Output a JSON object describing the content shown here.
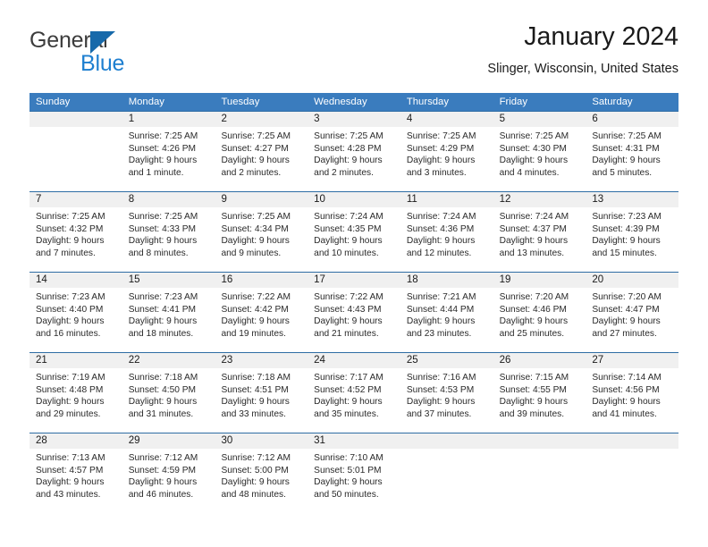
{
  "brand": {
    "name_top": "General",
    "name_bottom": "Blue",
    "accent_color": "#1769aa",
    "blue_text_color": "#1e7fd0"
  },
  "header": {
    "title": "January 2024",
    "subtitle": "Slinger, Wisconsin, United States"
  },
  "theme": {
    "header_bg": "#3a7cbe",
    "week_divider": "#2e6da4",
    "daynum_bg": "#f0f0f0"
  },
  "weekdays": [
    "Sunday",
    "Monday",
    "Tuesday",
    "Wednesday",
    "Thursday",
    "Friday",
    "Saturday"
  ],
  "weeks": [
    {
      "days": [
        {
          "num": "",
          "sunrise": "",
          "sunset": "",
          "daylight": ""
        },
        {
          "num": "1",
          "sunrise": "Sunrise: 7:25 AM",
          "sunset": "Sunset: 4:26 PM",
          "daylight": "Daylight: 9 hours and 1 minute."
        },
        {
          "num": "2",
          "sunrise": "Sunrise: 7:25 AM",
          "sunset": "Sunset: 4:27 PM",
          "daylight": "Daylight: 9 hours and 2 minutes."
        },
        {
          "num": "3",
          "sunrise": "Sunrise: 7:25 AM",
          "sunset": "Sunset: 4:28 PM",
          "daylight": "Daylight: 9 hours and 2 minutes."
        },
        {
          "num": "4",
          "sunrise": "Sunrise: 7:25 AM",
          "sunset": "Sunset: 4:29 PM",
          "daylight": "Daylight: 9 hours and 3 minutes."
        },
        {
          "num": "5",
          "sunrise": "Sunrise: 7:25 AM",
          "sunset": "Sunset: 4:30 PM",
          "daylight": "Daylight: 9 hours and 4 minutes."
        },
        {
          "num": "6",
          "sunrise": "Sunrise: 7:25 AM",
          "sunset": "Sunset: 4:31 PM",
          "daylight": "Daylight: 9 hours and 5 minutes."
        }
      ]
    },
    {
      "days": [
        {
          "num": "7",
          "sunrise": "Sunrise: 7:25 AM",
          "sunset": "Sunset: 4:32 PM",
          "daylight": "Daylight: 9 hours and 7 minutes."
        },
        {
          "num": "8",
          "sunrise": "Sunrise: 7:25 AM",
          "sunset": "Sunset: 4:33 PM",
          "daylight": "Daylight: 9 hours and 8 minutes."
        },
        {
          "num": "9",
          "sunrise": "Sunrise: 7:25 AM",
          "sunset": "Sunset: 4:34 PM",
          "daylight": "Daylight: 9 hours and 9 minutes."
        },
        {
          "num": "10",
          "sunrise": "Sunrise: 7:24 AM",
          "sunset": "Sunset: 4:35 PM",
          "daylight": "Daylight: 9 hours and 10 minutes."
        },
        {
          "num": "11",
          "sunrise": "Sunrise: 7:24 AM",
          "sunset": "Sunset: 4:36 PM",
          "daylight": "Daylight: 9 hours and 12 minutes."
        },
        {
          "num": "12",
          "sunrise": "Sunrise: 7:24 AM",
          "sunset": "Sunset: 4:37 PM",
          "daylight": "Daylight: 9 hours and 13 minutes."
        },
        {
          "num": "13",
          "sunrise": "Sunrise: 7:23 AM",
          "sunset": "Sunset: 4:39 PM",
          "daylight": "Daylight: 9 hours and 15 minutes."
        }
      ]
    },
    {
      "days": [
        {
          "num": "14",
          "sunrise": "Sunrise: 7:23 AM",
          "sunset": "Sunset: 4:40 PM",
          "daylight": "Daylight: 9 hours and 16 minutes."
        },
        {
          "num": "15",
          "sunrise": "Sunrise: 7:23 AM",
          "sunset": "Sunset: 4:41 PM",
          "daylight": "Daylight: 9 hours and 18 minutes."
        },
        {
          "num": "16",
          "sunrise": "Sunrise: 7:22 AM",
          "sunset": "Sunset: 4:42 PM",
          "daylight": "Daylight: 9 hours and 19 minutes."
        },
        {
          "num": "17",
          "sunrise": "Sunrise: 7:22 AM",
          "sunset": "Sunset: 4:43 PM",
          "daylight": "Daylight: 9 hours and 21 minutes."
        },
        {
          "num": "18",
          "sunrise": "Sunrise: 7:21 AM",
          "sunset": "Sunset: 4:44 PM",
          "daylight": "Daylight: 9 hours and 23 minutes."
        },
        {
          "num": "19",
          "sunrise": "Sunrise: 7:20 AM",
          "sunset": "Sunset: 4:46 PM",
          "daylight": "Daylight: 9 hours and 25 minutes."
        },
        {
          "num": "20",
          "sunrise": "Sunrise: 7:20 AM",
          "sunset": "Sunset: 4:47 PM",
          "daylight": "Daylight: 9 hours and 27 minutes."
        }
      ]
    },
    {
      "days": [
        {
          "num": "21",
          "sunrise": "Sunrise: 7:19 AM",
          "sunset": "Sunset: 4:48 PM",
          "daylight": "Daylight: 9 hours and 29 minutes."
        },
        {
          "num": "22",
          "sunrise": "Sunrise: 7:18 AM",
          "sunset": "Sunset: 4:50 PM",
          "daylight": "Daylight: 9 hours and 31 minutes."
        },
        {
          "num": "23",
          "sunrise": "Sunrise: 7:18 AM",
          "sunset": "Sunset: 4:51 PM",
          "daylight": "Daylight: 9 hours and 33 minutes."
        },
        {
          "num": "24",
          "sunrise": "Sunrise: 7:17 AM",
          "sunset": "Sunset: 4:52 PM",
          "daylight": "Daylight: 9 hours and 35 minutes."
        },
        {
          "num": "25",
          "sunrise": "Sunrise: 7:16 AM",
          "sunset": "Sunset: 4:53 PM",
          "daylight": "Daylight: 9 hours and 37 minutes."
        },
        {
          "num": "26",
          "sunrise": "Sunrise: 7:15 AM",
          "sunset": "Sunset: 4:55 PM",
          "daylight": "Daylight: 9 hours and 39 minutes."
        },
        {
          "num": "27",
          "sunrise": "Sunrise: 7:14 AM",
          "sunset": "Sunset: 4:56 PM",
          "daylight": "Daylight: 9 hours and 41 minutes."
        }
      ]
    },
    {
      "days": [
        {
          "num": "28",
          "sunrise": "Sunrise: 7:13 AM",
          "sunset": "Sunset: 4:57 PM",
          "daylight": "Daylight: 9 hours and 43 minutes."
        },
        {
          "num": "29",
          "sunrise": "Sunrise: 7:12 AM",
          "sunset": "Sunset: 4:59 PM",
          "daylight": "Daylight: 9 hours and 46 minutes."
        },
        {
          "num": "30",
          "sunrise": "Sunrise: 7:12 AM",
          "sunset": "Sunset: 5:00 PM",
          "daylight": "Daylight: 9 hours and 48 minutes."
        },
        {
          "num": "31",
          "sunrise": "Sunrise: 7:10 AM",
          "sunset": "Sunset: 5:01 PM",
          "daylight": "Daylight: 9 hours and 50 minutes."
        },
        {
          "num": "",
          "sunrise": "",
          "sunset": "",
          "daylight": ""
        },
        {
          "num": "",
          "sunrise": "",
          "sunset": "",
          "daylight": ""
        },
        {
          "num": "",
          "sunrise": "",
          "sunset": "",
          "daylight": ""
        }
      ]
    }
  ]
}
